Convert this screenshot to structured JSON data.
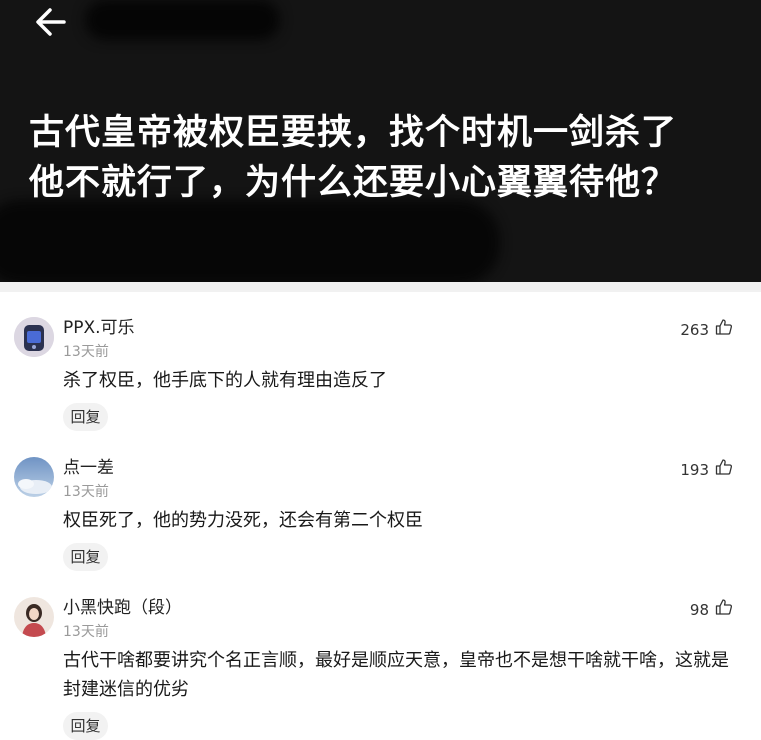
{
  "header": {
    "title_line1": "古代皇帝被权臣要挟，找个时机一剑杀了",
    "title_line2": "他不就行了，为什么还要小心翼翼待他？"
  },
  "comments": [
    {
      "username": "PPX.可乐",
      "time": "13天前",
      "text": "杀了权臣，他手底下的人就有理由造反了",
      "likes": "263",
      "reply_label": "回复"
    },
    {
      "username": "点一差",
      "time": "13天前",
      "text": "权臣死了，他的势力没死，还会有第二个权臣",
      "likes": "193",
      "reply_label": "回复"
    },
    {
      "username": "小黑快跑（段）",
      "time": "13天前",
      "text": "古代干啥都要讲究个名正言顺，最好是顺应天意，皇帝也不是想干啥就干啥，这就是封建迷信的优劣",
      "likes": "98",
      "reply_label": "回复"
    }
  ],
  "icons": {
    "back": "arrow-left-icon",
    "like": "thumbs-up-icon"
  }
}
